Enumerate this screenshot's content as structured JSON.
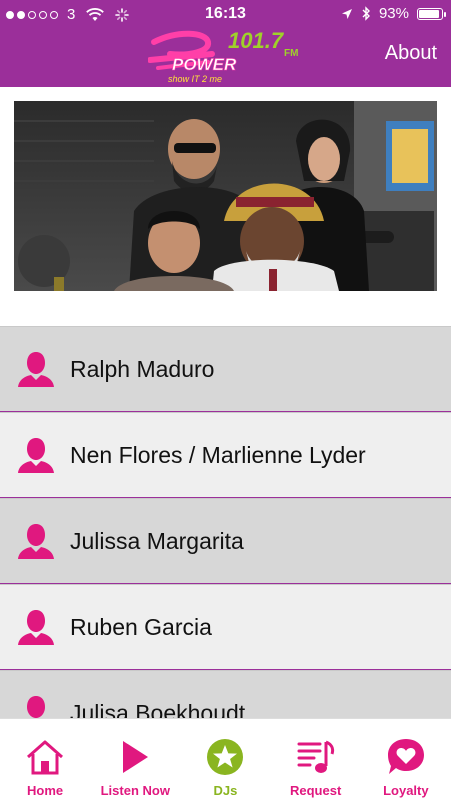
{
  "status_bar": {
    "carrier": "3",
    "time": "16:13",
    "battery": "93%",
    "battery_level": 0.93
  },
  "header": {
    "logo_alt": "Power 101.7 FM",
    "logo_text_main": "POWER",
    "logo_text_freq": "101.7",
    "logo_text_fm": "FM",
    "logo_tagline": "show IT 2 me",
    "about_label": "About"
  },
  "dj_list": {
    "items": [
      {
        "name": "Ralph Maduro"
      },
      {
        "name": "Nen Flores / Marlienne Lyder"
      },
      {
        "name": "Julissa Margarita"
      },
      {
        "name": "Ruben Garcia"
      },
      {
        "name": "Julisa Boekhoudt"
      }
    ]
  },
  "tabbar": {
    "tabs": [
      {
        "label": "Home",
        "icon": "home-icon"
      },
      {
        "label": "Listen Now",
        "icon": "play-icon"
      },
      {
        "label": "DJs",
        "icon": "star-icon",
        "active": true
      },
      {
        "label": "Request",
        "icon": "music-list-icon"
      },
      {
        "label": "Loyalty",
        "icon": "heart-chat-icon"
      }
    ]
  },
  "colors": {
    "brand_purple": "#9b2f9a",
    "accent_pink": "#e0187f",
    "active_green": "#8ab520"
  }
}
